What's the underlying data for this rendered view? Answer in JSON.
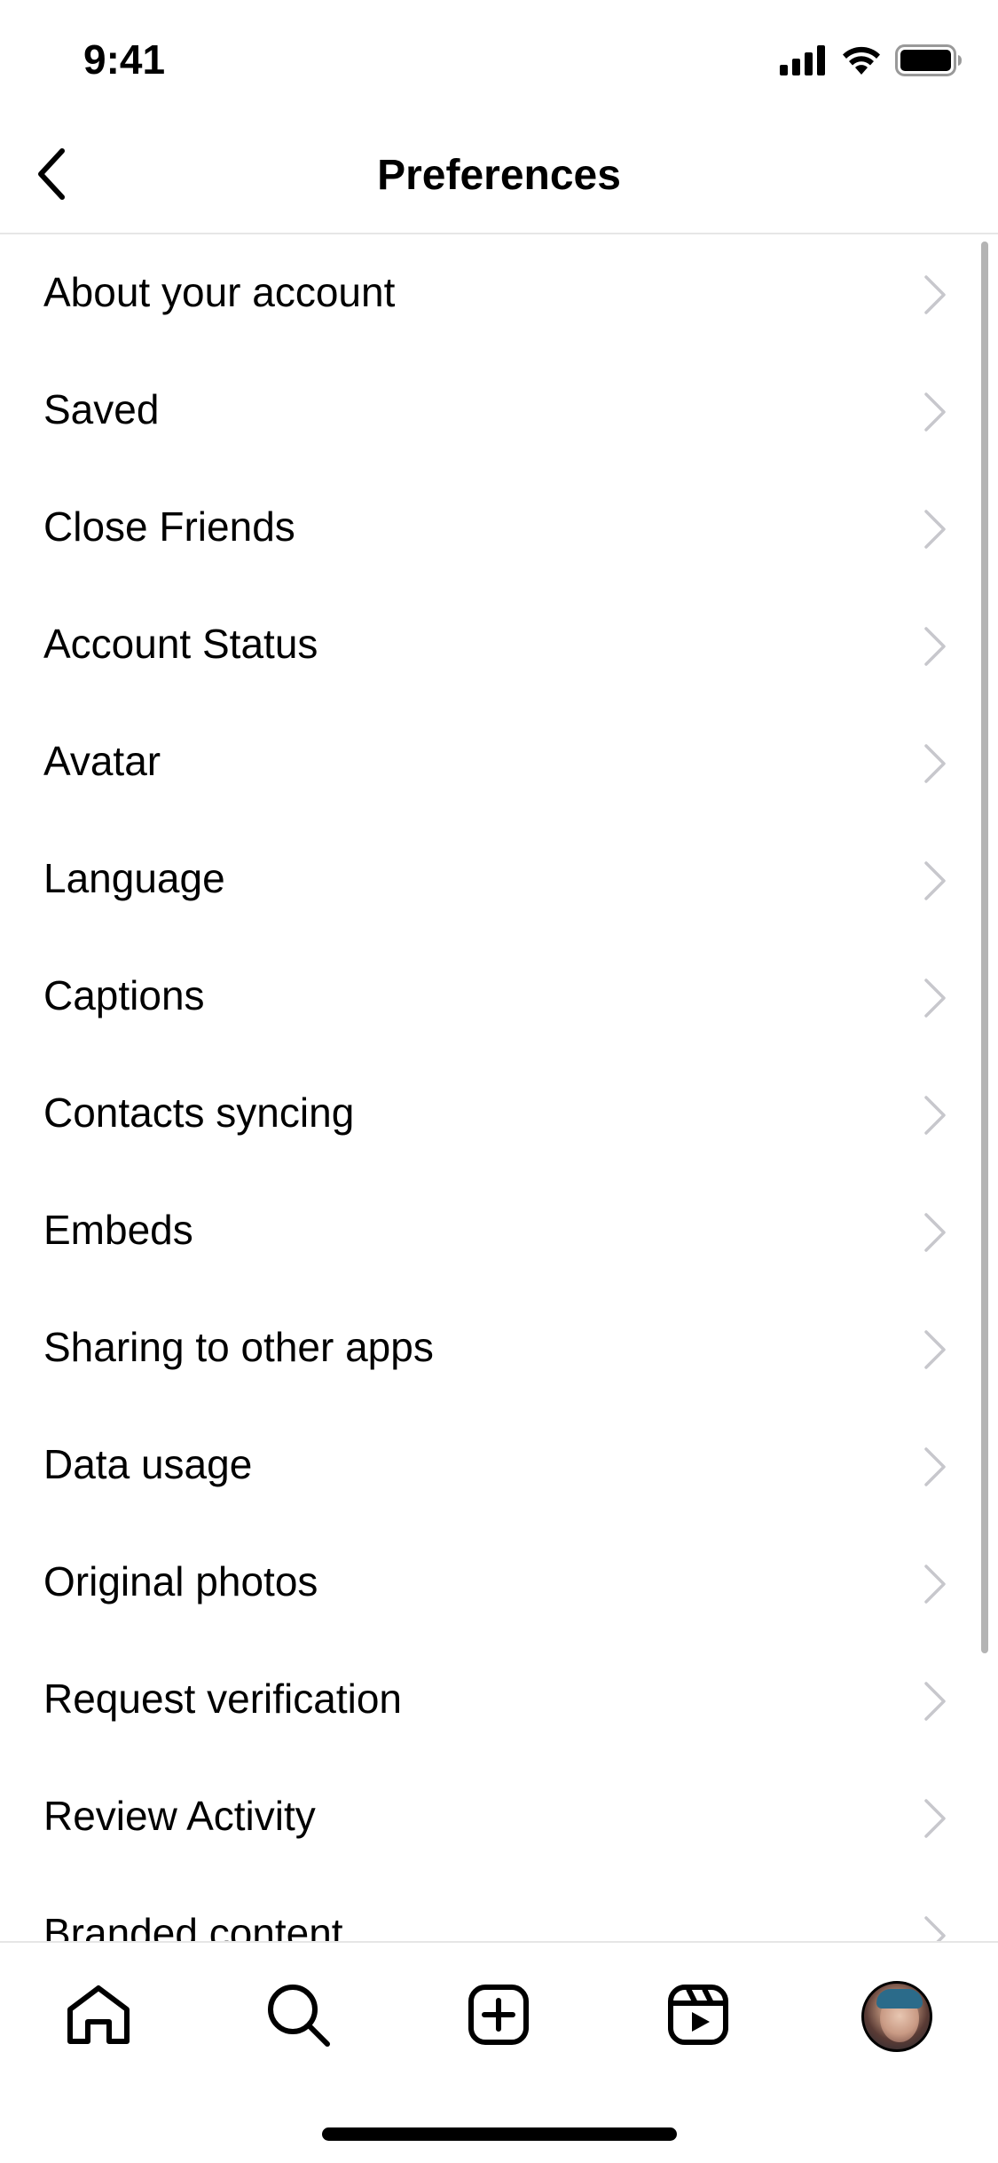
{
  "status_bar": {
    "time": "9:41"
  },
  "header": {
    "title": "Preferences"
  },
  "list": {
    "items": [
      {
        "label": "About your account"
      },
      {
        "label": "Saved"
      },
      {
        "label": "Close Friends"
      },
      {
        "label": "Account Status"
      },
      {
        "label": "Avatar"
      },
      {
        "label": "Language"
      },
      {
        "label": "Captions"
      },
      {
        "label": "Contacts syncing"
      },
      {
        "label": "Embeds"
      },
      {
        "label": "Sharing to other apps"
      },
      {
        "label": "Data usage"
      },
      {
        "label": "Original photos"
      },
      {
        "label": "Request verification"
      },
      {
        "label": "Review Activity"
      },
      {
        "label": "Branded content"
      }
    ]
  },
  "tab_bar": {
    "tabs": [
      {
        "icon": "home-icon"
      },
      {
        "icon": "search-icon"
      },
      {
        "icon": "create-icon"
      },
      {
        "icon": "reels-icon"
      },
      {
        "icon": "profile-avatar"
      }
    ]
  },
  "colors": {
    "text": "#000000",
    "chevron": "#c7c7cc",
    "divider": "#e6e6e6",
    "scrollbar": "#b4b4b4"
  }
}
